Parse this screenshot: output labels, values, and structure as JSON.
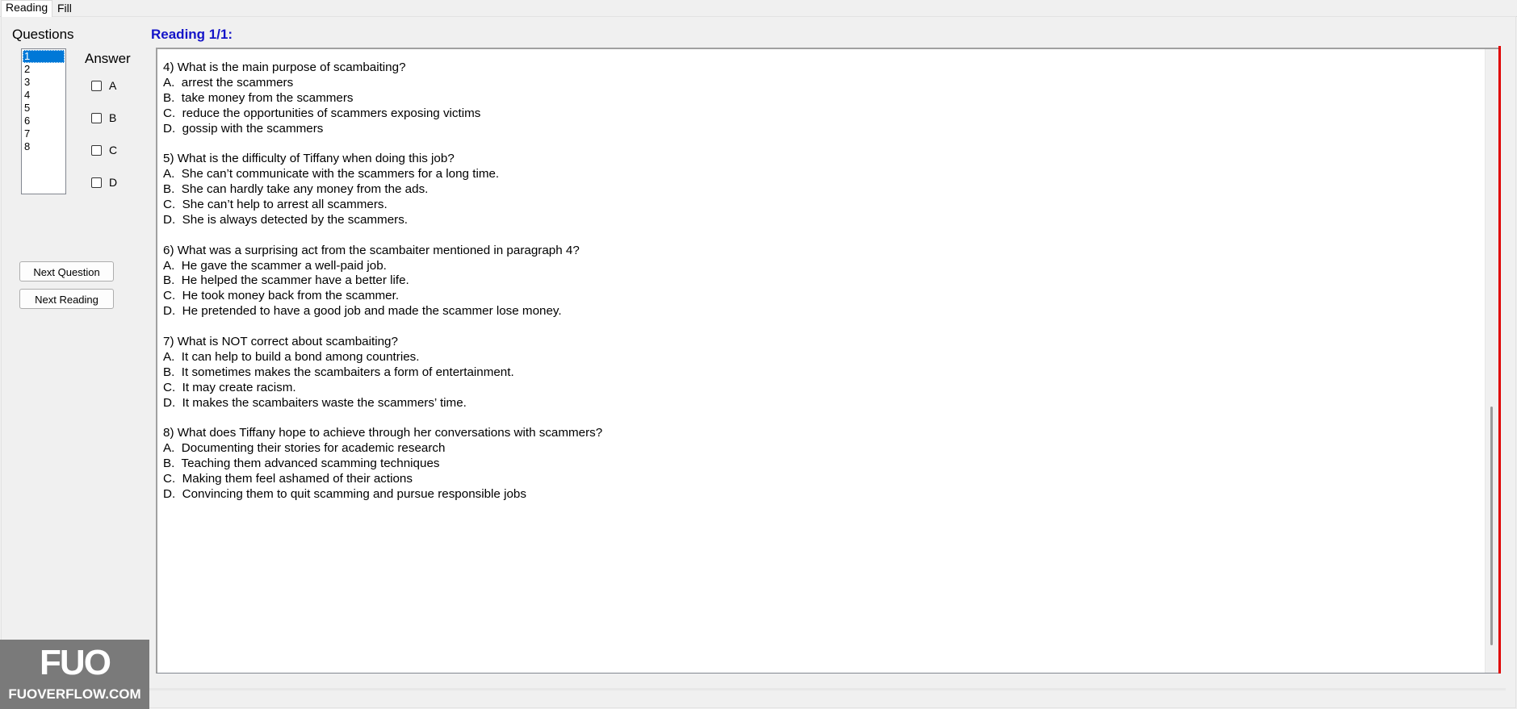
{
  "tabs": [
    {
      "label": "Reading",
      "active": true
    },
    {
      "label": "Fill Blank",
      "active": false
    }
  ],
  "left_panel": {
    "questions_title": "Questions",
    "answer_title": "Answer",
    "question_numbers": [
      "1",
      "2",
      "3",
      "4",
      "5",
      "6",
      "7",
      "8"
    ],
    "selected_index": 0,
    "options": [
      "A",
      "B",
      "C",
      "D"
    ],
    "next_question_label": "Next Question",
    "next_reading_label": "Next Reading"
  },
  "reading": {
    "title": "Reading 1/1:",
    "questions": [
      {
        "stem": "4) What is the main purpose of scambaiting?",
        "choices": [
          "A.  arrest the scammers",
          "B.  take money from the scammers",
          "C.  reduce the opportunities of scammers exposing victims",
          "D.  gossip with the scammers"
        ]
      },
      {
        "stem": "5) What is the difficulty of Tiffany when doing this job?",
        "choices": [
          "A.  She can’t communicate with the scammers for a long time.",
          "B.  She can hardly take any money from the ads.",
          "C.  She can’t help to arrest all scammers.",
          "D.  She is always detected by the scammers."
        ]
      },
      {
        "stem": "6) What was a surprising act from the scambaiter mentioned in paragraph 4?",
        "choices": [
          "A.  He gave the scammer a well-paid job.",
          "B.  He helped the scammer have a better life.",
          "C.  He took money back from the scammer.",
          "D.  He pretended to have a good job and made the scammer lose money."
        ]
      },
      {
        "stem": "7) What is NOT correct about scambaiting?",
        "choices": [
          "A.  It can help to build a bond among countries.",
          "B.  It sometimes makes the scambaiters a form of entertainment.",
          "C.  It may create racism.",
          "D.  It makes the scambaiters waste the scammers’ time."
        ]
      },
      {
        "stem": "8) What does Tiffany hope to achieve through her conversations with scammers?",
        "choices": [
          "A.  Documenting their stories for academic research",
          "B.  Teaching them advanced scamming techniques",
          "C.  Making them feel ashamed of their actions",
          "D.  Convincing them to quit scamming and pursue responsible jobs"
        ]
      }
    ]
  },
  "watermark": {
    "logo": "FUO",
    "site": "FUOVERFLOW.COM"
  },
  "colors": {
    "reading_title": "#1414c8",
    "selection": "#0078d7",
    "red_rule": "#e00000"
  }
}
